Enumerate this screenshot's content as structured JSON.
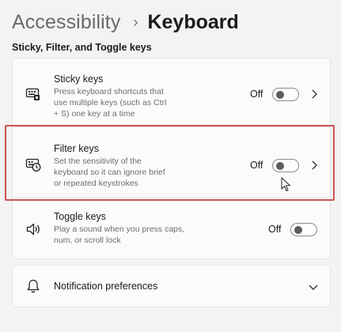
{
  "breadcrumb": {
    "parent": "Accessibility",
    "separator": "›",
    "current": "Keyboard"
  },
  "section": {
    "title": "Sticky, Filter, and Toggle keys"
  },
  "settings": [
    {
      "title": "Sticky keys",
      "desc_lines": [
        "Press keyboard shortcuts that",
        "use multiple keys (such as Ctrl",
        "+ S) one key at a time"
      ],
      "state": "Off",
      "icon": "sticky-keys-icon"
    },
    {
      "title": "Filter keys",
      "desc_lines": [
        "Set the sensitivity of the",
        "keyboard so it can ignore brief",
        "or repeated keystrokes"
      ],
      "state": "Off",
      "icon": "filter-keys-icon"
    },
    {
      "title": "Toggle keys",
      "desc_lines": [
        "Play a sound when you press caps,",
        "num, or scroll lock"
      ],
      "state": "Off",
      "icon": "speaker-icon"
    }
  ],
  "notifications": {
    "label": "Notification preferences",
    "icon": "bell-icon"
  },
  "colors": {
    "background": "#f3f3f3",
    "card": "#fbfbfb",
    "highlight": "#cc5353",
    "toggle_off_knob": "#5c5c5c"
  }
}
